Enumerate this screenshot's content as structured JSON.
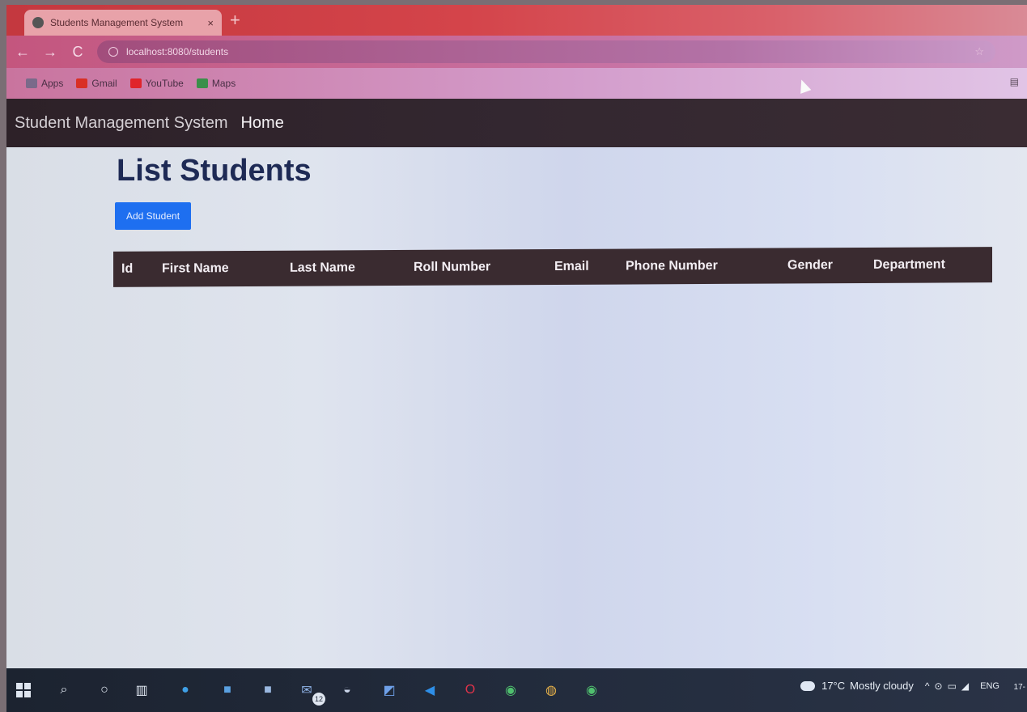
{
  "browser": {
    "tab_title": "Students Management System",
    "tab_close": "×",
    "new_tab": "+",
    "url": "localhost:8080/students",
    "nav": {
      "back": "←",
      "forward": "→",
      "reload": "C"
    },
    "bookmarks": [
      {
        "label": "Apps",
        "icon": "apps-grid-icon",
        "color": "#7a6a8a"
      },
      {
        "label": "Gmail",
        "icon": "gmail-icon",
        "color": "#d93025"
      },
      {
        "label": "YouTube",
        "icon": "youtube-icon",
        "color": "#e0242b"
      },
      {
        "label": "Maps",
        "icon": "maps-icon",
        "color": "#3a8f4a"
      }
    ]
  },
  "app": {
    "brand": "Student Management System",
    "nav_home": "Home",
    "page_title": "List Students",
    "add_button": "Add Student",
    "table": {
      "columns": [
        "Id",
        "First Name",
        "Last Name",
        "Roll Number",
        "Email",
        "Phone Number",
        "Gender",
        "Department"
      ],
      "rows": []
    }
  },
  "taskbar": {
    "weather_temp": "17°C",
    "weather_text": "Mostly cloudy",
    "lang": "ENG",
    "mail_badge": "12",
    "clock_date": "17-"
  },
  "colors": {
    "navbar": "#2d2128",
    "table_header": "#3a2b30",
    "primary": "#1e6ff0",
    "title": "#1e2a55"
  }
}
